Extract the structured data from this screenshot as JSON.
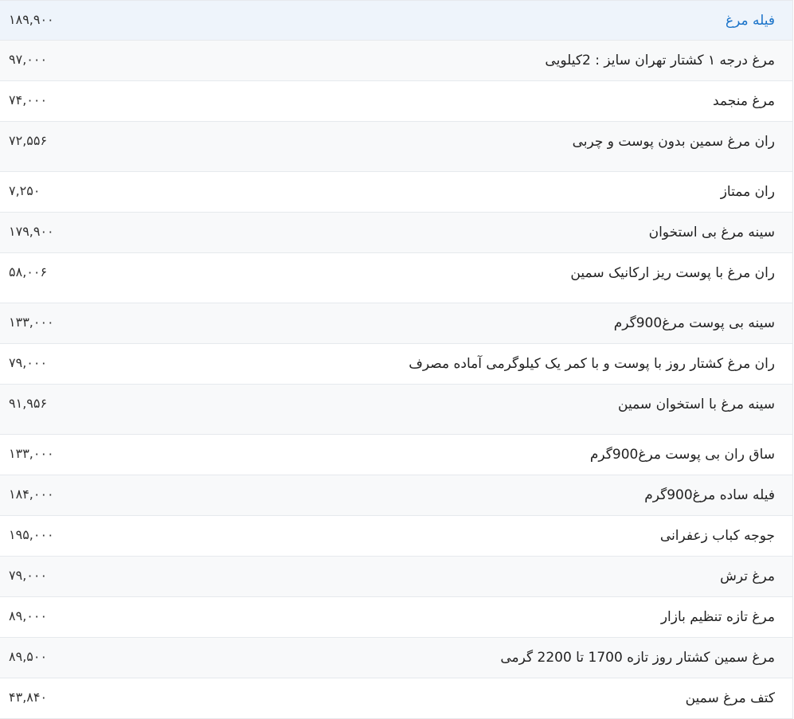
{
  "table": {
    "rows": [
      {
        "name": "فیله مرغ",
        "price": "۱۸۹,۹۰۰"
      },
      {
        "name": "مرغ درجه ۱ کشتار تهران سایز : 2کیلویی",
        "price": "۹۷,۰۰۰"
      },
      {
        "name": "مرغ منجمد",
        "price": "۷۴,۰۰۰"
      },
      {
        "name": "ران مرغ سمین بدون پوست و چربی",
        "price": "۷۲,۵۵۶"
      },
      {
        "name": "ران ممتاز",
        "price": "۷,۲۵۰"
      },
      {
        "name": "سینه مرغ بی استخوان",
        "price": "۱۷۹,۹۰۰"
      },
      {
        "name": "ران مرغ با پوست ریز ارکانیک سمین",
        "price": "۵۸,۰۰۶"
      },
      {
        "name": "سینه بی پوست مرغ900گرم",
        "price": "۱۳۳,۰۰۰"
      },
      {
        "name": "ران مرغ کشتار روز با پوست و با کمر یک کیلوگرمی آماده مصرف",
        "price": "۷۹,۰۰۰"
      },
      {
        "name": "سینه مرغ با استخوان سمین",
        "price": "۹۱,۹۵۶"
      },
      {
        "name": "ساق ران بی پوست مرغ900گرم",
        "price": "۱۳۳,۰۰۰"
      },
      {
        "name": "فیله ساده مرغ900گرم",
        "price": "۱۸۴,۰۰۰"
      },
      {
        "name": "جوجه کباب زعفرانی",
        "price": "۱۹۵,۰۰۰"
      },
      {
        "name": "مرغ ترش",
        "price": "۷۹,۰۰۰"
      },
      {
        "name": "مرغ تازه تنظیم بازار",
        "price": "۸۹,۰۰۰"
      },
      {
        "name": "مرغ سمین کشتار روز تازه 1700 تا 2200 گرمی",
        "price": "۸۹,۵۰۰"
      },
      {
        "name": "کتف مرغ سمین",
        "price": "۴۳,۸۴۰"
      }
    ]
  }
}
